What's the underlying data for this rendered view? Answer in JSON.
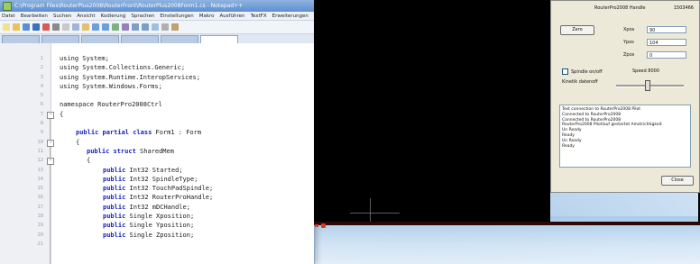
{
  "notepad": {
    "title": "C:\\Program Files\\RouterPlus2008\\RouterFront\\RouterPlus2008Form1.cs - Notepad++",
    "menu": [
      "Datei",
      "Bearbeiten",
      "Suchen",
      "Ansicht",
      "Kodierung",
      "Sprachen",
      "Einstellungen",
      "Makro",
      "Ausführen",
      "TextFX",
      "Erweiterungen"
    ],
    "toolbar_icons": [
      "new-icon",
      "open-icon",
      "save-icon",
      "save-all-icon",
      "close-icon",
      "print-icon",
      "cut-icon",
      "copy-icon",
      "paste-icon",
      "undo-icon",
      "redo-icon",
      "find-icon",
      "replace-icon",
      "zoom-in-icon",
      "zoom-out-icon",
      "sync-icon",
      "wrap-icon",
      "indent-icon"
    ],
    "tab_count": 6,
    "code_lines": [
      {
        "n": "1",
        "pre": "using ",
        "kw": "",
        "post": "System;",
        "indent": 0
      },
      {
        "n": "2",
        "pre": "using ",
        "kw": "",
        "post": "System.Collections.Generic;",
        "indent": 0
      },
      {
        "n": "3",
        "pre": "using ",
        "kw": "",
        "post": "System.Runtime.InteropServices;",
        "indent": 0
      },
      {
        "n": "4",
        "pre": "using ",
        "kw": "",
        "post": "System.Windows.Forms;",
        "indent": 0
      },
      {
        "n": "5",
        "pre": "",
        "kw": "",
        "post": "",
        "indent": 0
      },
      {
        "n": "6",
        "pre": "namespace ",
        "kw": "",
        "post": "RouterPro2008Ctrl",
        "indent": 0
      },
      {
        "n": "7",
        "pre": "",
        "kw": "",
        "post": "{",
        "indent": 0
      },
      {
        "n": "8",
        "pre": "",
        "kw": "",
        "post": "",
        "indent": 0
      },
      {
        "n": "9",
        "pre": "",
        "kw": "public partial class ",
        "post": "Form1 : Form",
        "indent": 3
      },
      {
        "n": "10",
        "pre": "",
        "kw": "",
        "post": "{",
        "indent": 3
      },
      {
        "n": "11",
        "pre": "",
        "kw": "public struct ",
        "post": "SharedMem",
        "indent": 5
      },
      {
        "n": "12",
        "pre": "",
        "kw": "",
        "post": "{",
        "indent": 5
      },
      {
        "n": "13",
        "pre": "",
        "kw": "public ",
        "post": "Int32 Started;",
        "indent": 8
      },
      {
        "n": "14",
        "pre": "",
        "kw": "public ",
        "post": "Int32 SpindleType;",
        "indent": 8
      },
      {
        "n": "15",
        "pre": "",
        "kw": "public ",
        "post": "Int32 TouchPadSpindle;",
        "indent": 8
      },
      {
        "n": "16",
        "pre": "",
        "kw": "public ",
        "post": "Int32 RouterProHandle;",
        "indent": 8
      },
      {
        "n": "17",
        "pre": "",
        "kw": "public ",
        "post": "Int32 mDCHandle;",
        "indent": 8
      },
      {
        "n": "18",
        "pre": "",
        "kw": "public ",
        "post": "Single Xposition;",
        "indent": 8
      },
      {
        "n": "19",
        "pre": "",
        "kw": "public ",
        "post": "Single Yposition;",
        "indent": 8
      },
      {
        "n": "20",
        "pre": "",
        "kw": "public ",
        "post": "Single Zposition;",
        "indent": 8
      },
      {
        "n": "21",
        "pre": "",
        "kw": "",
        "post": "",
        "indent": 8
      }
    ]
  },
  "panel": {
    "handle_label": "RouterPro2008 Handle",
    "handle_value": "1503466",
    "zero_button": "Zero",
    "fields": [
      {
        "label": "Xpos",
        "value": "90"
      },
      {
        "label": "Ypos",
        "value": "104"
      },
      {
        "label": "Zpos",
        "value": "0"
      }
    ],
    "spindle_label": "Spindle on/off",
    "speed_label": "Speed 8000",
    "scale_label": "Kinetik datenoff",
    "log_lines": [
      "Test connection to RouterPro2008 Pilot",
      "Connected to RouterPro2008",
      "Connected to RouterPro2008",
      "RouterPro2008 Pilotlauf gestartet Amstrichtigkeit",
      "Un Ready",
      "Ready",
      "Un Ready",
      "Ready"
    ],
    "close_button": "Close"
  }
}
